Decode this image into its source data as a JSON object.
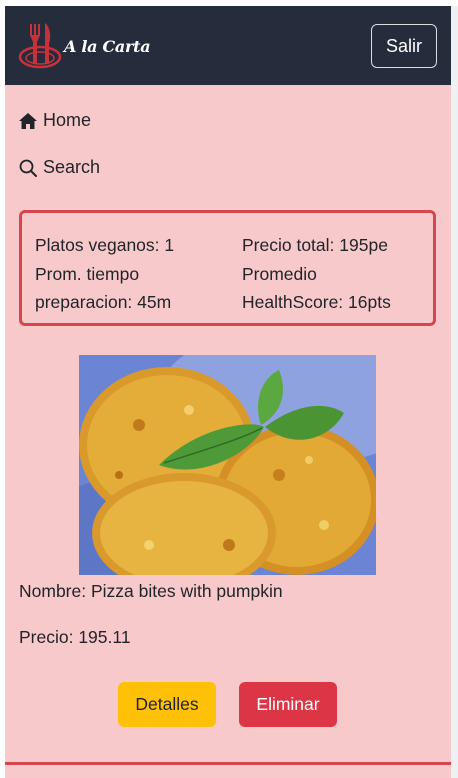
{
  "navbar": {
    "brand_text": "A la Carta",
    "logout_label": "Salir",
    "background": "#252d3d"
  },
  "nav": {
    "home_label": "Home",
    "home_icon": "house-icon",
    "search_label": "Search",
    "search_icon": "magnifier-icon"
  },
  "stats": {
    "vegan_dishes": "Platos veganos: 1",
    "avg_time_line1": "Prom. tiempo",
    "avg_time_line2": "preparacion: 45m",
    "total_price": "Precio total: 195pe",
    "avg_health_line1": "Promedio",
    "avg_health_line2": "HealthScore: 16pts",
    "border_color": "#d4474f"
  },
  "dish": {
    "name": "Nombre: Pizza bites with pumpkin",
    "price": "Precio: 195.11",
    "details_button": "Detalles",
    "delete_button": "Eliminar"
  },
  "colors": {
    "page_background": "#f8c9cb",
    "details_button": "#ffc107",
    "delete_button": "#dc3545"
  }
}
